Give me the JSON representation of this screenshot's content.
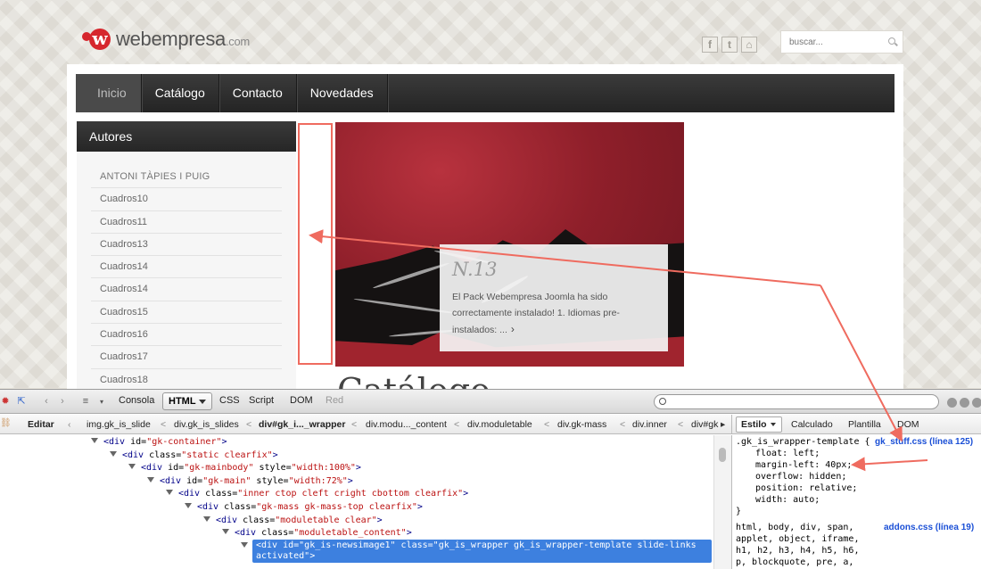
{
  "site": {
    "logo_text": "webempresa",
    "logo_tld": ".com",
    "search_placeholder": "buscar...",
    "social": [
      "f",
      "t",
      "⌂"
    ],
    "nav": [
      "Inicio",
      "Catálogo",
      "Contacto",
      "Novedades"
    ],
    "sidebar": {
      "title": "Autores",
      "items": [
        "ANTONI TÀPIES I PUIG",
        "Cuadros10",
        "Cuadros11",
        "Cuadros13",
        "Cuadros14",
        "Cuadros14",
        "Cuadros15",
        "Cuadros16",
        "Cuadros17",
        "Cuadros18"
      ]
    },
    "caption": {
      "title": "N.13",
      "text": "El Pack Webempresa Joomla ha sido correctamente instalado! 1. Idiomas pre-instalados: ...",
      "more": "›"
    },
    "heading_fragment": "Catálogo"
  },
  "devtools": {
    "tabs": [
      "Consola",
      "HTML",
      "CSS",
      "Script",
      "DOM",
      "Red"
    ],
    "active_tab": "HTML",
    "edit_label": "Editar",
    "breadcrumbs": [
      "img.gk_is_slide",
      "div.gk_is_slides",
      "div#gk_i..._wrapper",
      "div.modu..._content",
      "div.moduletable",
      "div.gk-mass",
      "div.inner",
      "div#gk"
    ],
    "side_tabs": [
      "Estilo",
      "Calculado",
      "Plantilla",
      "DOM"
    ],
    "tree": [
      {
        "tag": "div",
        "attrs": [
          [
            "id",
            "gk-container"
          ]
        ]
      },
      {
        "tag": "div",
        "attrs": [
          [
            "class",
            "static clearfix"
          ]
        ]
      },
      {
        "tag": "div",
        "attrs": [
          [
            "id",
            "gk-mainbody"
          ],
          [
            "style",
            "width:100%"
          ]
        ]
      },
      {
        "tag": "div",
        "attrs": [
          [
            "id",
            "gk-main"
          ],
          [
            "style",
            "width:72%"
          ]
        ]
      },
      {
        "tag": "div",
        "attrs": [
          [
            "class",
            "inner ctop cleft cright cbottom clearfix"
          ]
        ]
      },
      {
        "tag": "div",
        "attrs": [
          [
            "class",
            "gk-mass gk-mass-top clearfix"
          ]
        ]
      },
      {
        "tag": "div",
        "attrs": [
          [
            "class",
            "moduletable clear"
          ]
        ]
      },
      {
        "tag": "div",
        "attrs": [
          [
            "class",
            "moduletable_content"
          ]
        ]
      }
    ],
    "selected_line1": "<div id=\"gk_is-newsimage1\" class=\"gk_is_wrapper gk_is_wrapper-template slide-links",
    "selected_line2": "activated\">",
    "css_rules": [
      {
        "selector": ".gk_is_wrapper-template {",
        "source": "gk_stuff.css (línea 125)",
        "props": [
          [
            "float",
            "left;"
          ],
          [
            "margin-left",
            "40px;"
          ],
          [
            "overflow",
            "hidden;"
          ],
          [
            "position",
            "relative;"
          ],
          [
            "width",
            "auto;"
          ]
        ]
      }
    ],
    "rule2_selector_lines": [
      "html, body, div, span,",
      "applet, object, iframe,",
      "h1, h2, h3, h4, h5, h6,",
      "p, blockquote, pre, a,"
    ],
    "rule2_source": "addons.css (línea 19)",
    "annotation_color": "#ef6b5f",
    "selection_color": "#3d80df"
  }
}
